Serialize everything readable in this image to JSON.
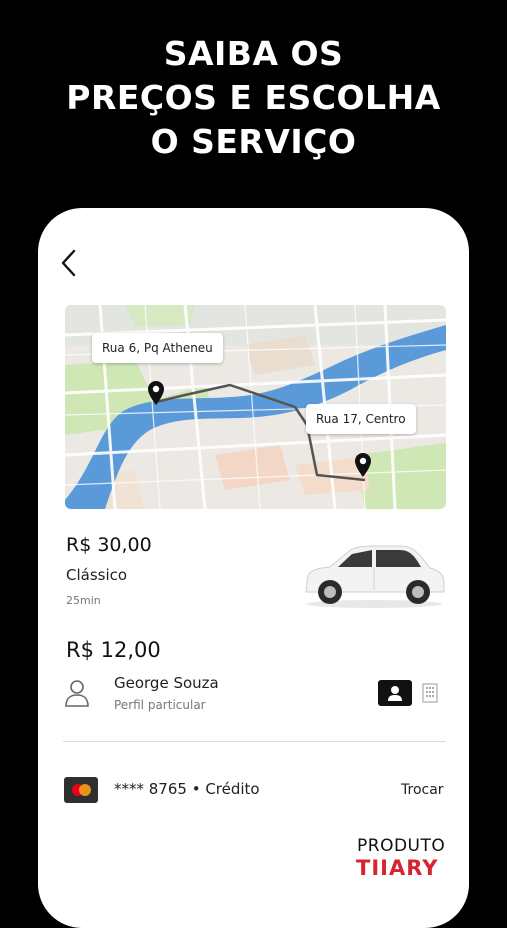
{
  "headline": [
    "SAIBA OS",
    "PREÇOS E ESCOLHA",
    "O SERVIÇO"
  ],
  "map": {
    "origin_label": "Rua 6, Pq Atheneu",
    "destination_label": "Rua 17, Centro"
  },
  "service": {
    "price": "R$ 30,00",
    "name": "Clássico",
    "duration": "25min"
  },
  "fare": {
    "price": "R$ 12,00"
  },
  "user": {
    "name": "George Souza",
    "profile": "Perfil particular"
  },
  "payment": {
    "card_text": "**** 8765 • Crédito",
    "change_label": "Trocar"
  },
  "brand": {
    "line1": "PRODUTO",
    "line2": "TIIARY"
  },
  "colors": {
    "background": "#000000",
    "map_water": "#5b9ad8",
    "map_park": "#cfe6b5",
    "route": "#555555",
    "brand_red": "#d8242f"
  },
  "icons": [
    "back-arrow-icon",
    "map-pin-icon",
    "car-image",
    "person-icon",
    "id-card-icon",
    "building-icon",
    "mastercard-icon"
  ]
}
